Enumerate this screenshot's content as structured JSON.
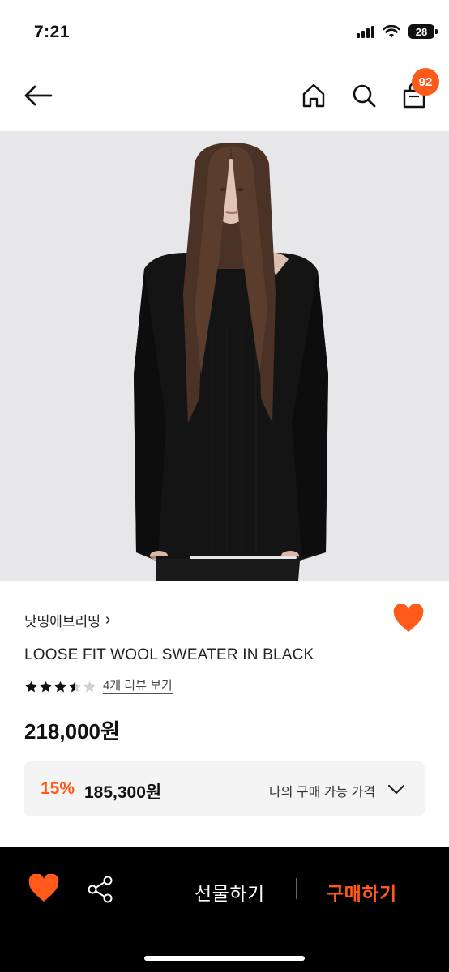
{
  "status_bar": {
    "time": "7:21",
    "battery": "28",
    "icons": [
      "cellular-signal-icon",
      "wifi-icon",
      "battery-icon"
    ]
  },
  "nav": {
    "icons": [
      "back-arrow-icon",
      "home-icon",
      "search-icon",
      "shopping-bag-icon"
    ],
    "cart_count": "92"
  },
  "product": {
    "brand": "낫띵에브리띵",
    "brand_chevron": "›",
    "name": "LOOSE FIT WOOL SWEATER IN BLACK",
    "rating": 3.5,
    "rating_max": 5,
    "review_link": "4개 리뷰 보기",
    "price": "218,000원",
    "deal": {
      "discount": "15%",
      "price": "185,300원",
      "label": "나의 구매 가능 가격"
    },
    "image_gallery": {
      "current_index": 1,
      "position_fraction": 0.27
    }
  },
  "bottom_bar": {
    "gift_label": "선물하기",
    "buy_label": "구매하기"
  },
  "colors": {
    "accent": "#ff5a1a",
    "bottom_bar_bg": "#000000",
    "deal_box_bg": "#f4f4f5",
    "hero_bg": "#e7e7e9"
  }
}
